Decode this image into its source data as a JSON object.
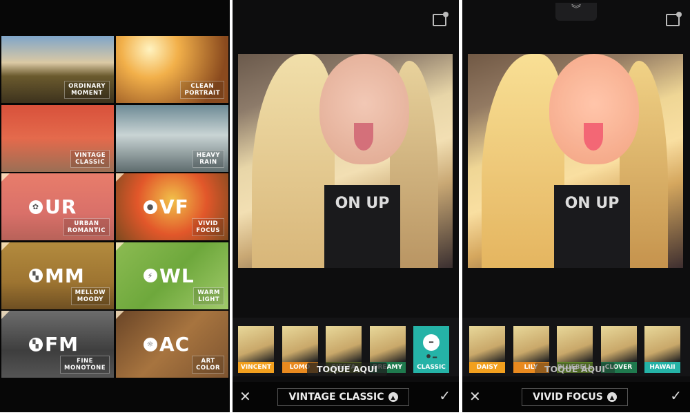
{
  "presets": [
    {
      "label1": "ORDINARY",
      "label2": "MOMENT",
      "bg": "linear-gradient(180deg,#7fa5c9 0%,#dbc9a4 40%,#6b5a2e 60%,#3d331d 100%)"
    },
    {
      "label1": "CLEAN",
      "label2": "PORTRAIT",
      "bg": "radial-gradient(circle at 30% 20%,#fff3c0,#f2b04a 30%,#8a4a1e 80%)"
    },
    {
      "label1": "VINTAGE",
      "label2": "CLASSIC",
      "bg": "linear-gradient(180deg,#d8513b 0%,#e46a4c 50%,#9b6f55 100%)"
    },
    {
      "label1": "HEAVY",
      "label2": "RAIN",
      "bg": "linear-gradient(180deg,#6d8a95 0%,#c9d4d4 45%,#5e6c6e 100%)"
    },
    {
      "abbr": "UR",
      "icon": "flower-icon",
      "label1": "URBAN",
      "label2": "ROMANTIC",
      "bg": "linear-gradient(180deg,#e87d6b,#d97069 60%,#b86259)"
    },
    {
      "abbr": "VF",
      "icon": "drop-icon",
      "label1": "VIVID",
      "label2": "FOCUS",
      "bg": "radial-gradient(circle at 50% 40%,#f1c14a,#e2572a 50%,#7c4a1f)"
    },
    {
      "abbr": "MM",
      "icon": "checker-icon",
      "label1": "MELLOW",
      "label2": "MOODY",
      "bg": "linear-gradient(180deg,#b38b3e,#9d7431 60%,#6e4f22)"
    },
    {
      "abbr": "WL",
      "icon": "lightning-icon",
      "label1": "WARM",
      "label2": "LIGHT",
      "bg": "linear-gradient(135deg,#8cbb52,#6ea83c 50%,#a2cb6b)"
    },
    {
      "abbr": "FM",
      "icon": "checker-icon",
      "label1": "FINE",
      "label2": "MONOTONE",
      "bg": "linear-gradient(180deg,#6d6d6d,#3e3e3e 60%,#555)"
    },
    {
      "abbr": "AC",
      "icon": "sun-icon",
      "label1": "ART",
      "label2": "COLOR",
      "bg": "linear-gradient(135deg,#6a4527,#a7743f 50%,#7d5430)"
    }
  ],
  "screen2": {
    "filters": [
      {
        "label": "VINCENT",
        "color": "#f2a01e"
      },
      {
        "label": "LOMO",
        "color": "#e98a1f"
      },
      {
        "label": "SIESTA",
        "color": "#6a7a2a"
      },
      {
        "label": "DREAMY",
        "color": "#1f7a4e"
      },
      {
        "label": "CLASSIC",
        "color": "#25b3a7"
      }
    ],
    "tooltip": "TOQUE AQUI",
    "preset_name": "VINTAGE CLASSIC",
    "shirt_text": "ON UP"
  },
  "screen3": {
    "filters": [
      {
        "label": "DAISY",
        "color": "#f2a01e"
      },
      {
        "label": "LILY",
        "color": "#e98a1f"
      },
      {
        "label": "BLUEBELL",
        "color": "#6f9a2c"
      },
      {
        "label": "CLOVER",
        "color": "#1f7a4e"
      },
      {
        "label": "HAWAII",
        "color": "#25b3a7"
      }
    ],
    "tooltip": "TOQUE AQUI",
    "preset_name": "VIVID FOCUS",
    "shirt_text": "ON UP"
  },
  "icons": {
    "close": "close-icon",
    "confirm": "checkmark-icon",
    "expand": "triangle-up-icon",
    "compare": "compare-icon"
  }
}
